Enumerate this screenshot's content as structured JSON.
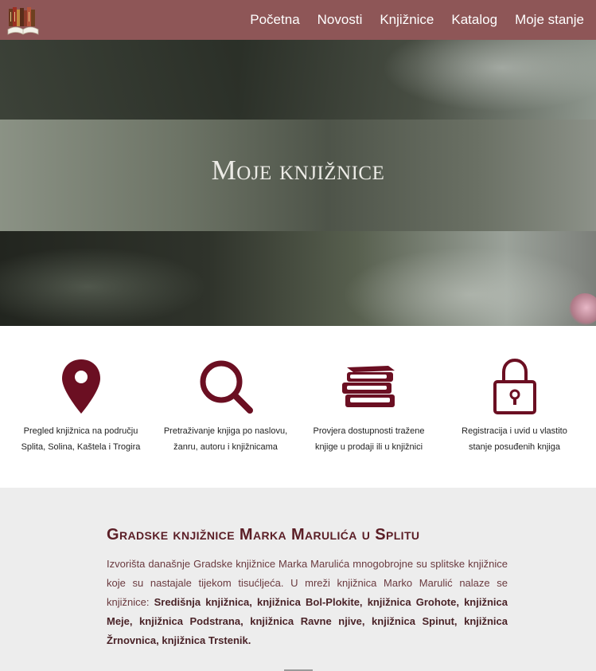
{
  "colors": {
    "navbar": "#8e5657",
    "accent_icon": "#6b0f22",
    "heading": "#5b1e26",
    "section_bg": "#ededed"
  },
  "nav": {
    "logo_icon": "books-logo-icon",
    "items": [
      "Početna",
      "Novosti",
      "Knjižnice",
      "Katalog",
      "Moje stanje"
    ]
  },
  "hero": {
    "title": "Moje knjižnice"
  },
  "features": [
    {
      "icon": "map-pin-icon",
      "line1": "Pregled knjižnica na području",
      "line2": "Splita, Solina, Kaštela i Trogira"
    },
    {
      "icon": "search-icon",
      "line1": "Pretraživanje knjiga po naslovu,",
      "line2": "žanru, autoru i knjižnicama"
    },
    {
      "icon": "books-icon",
      "line1": "Provjera dostupnosti tražene",
      "line2": "knjige u prodaji ili u knjižnici"
    },
    {
      "icon": "lock-icon",
      "line1": "Registracija i uvid u vlastito",
      "line2": "stanje posuđenih knjiga"
    }
  ],
  "about": {
    "title": "Gradske knjižnice Marka Marulića u Splitu",
    "intro": "Izvorišta današnje Gradske knjižnice Marka Marulića mnogobrojne su splitske knjižnice koje su nastajale tijekom tisućljeća. U mreži knjižnica Marko Marulić nalaze se knjižnice:",
    "libraries": "Središnja knjižnica, knjižnica Bol-Plokite, knjižnica Grohote, knjižnica Meje, knjižnica Podstrana, knjižnica Ravne njive, knjižnica Spinut, knjižnica Žrnovnica, knjižnica Trstenik."
  }
}
